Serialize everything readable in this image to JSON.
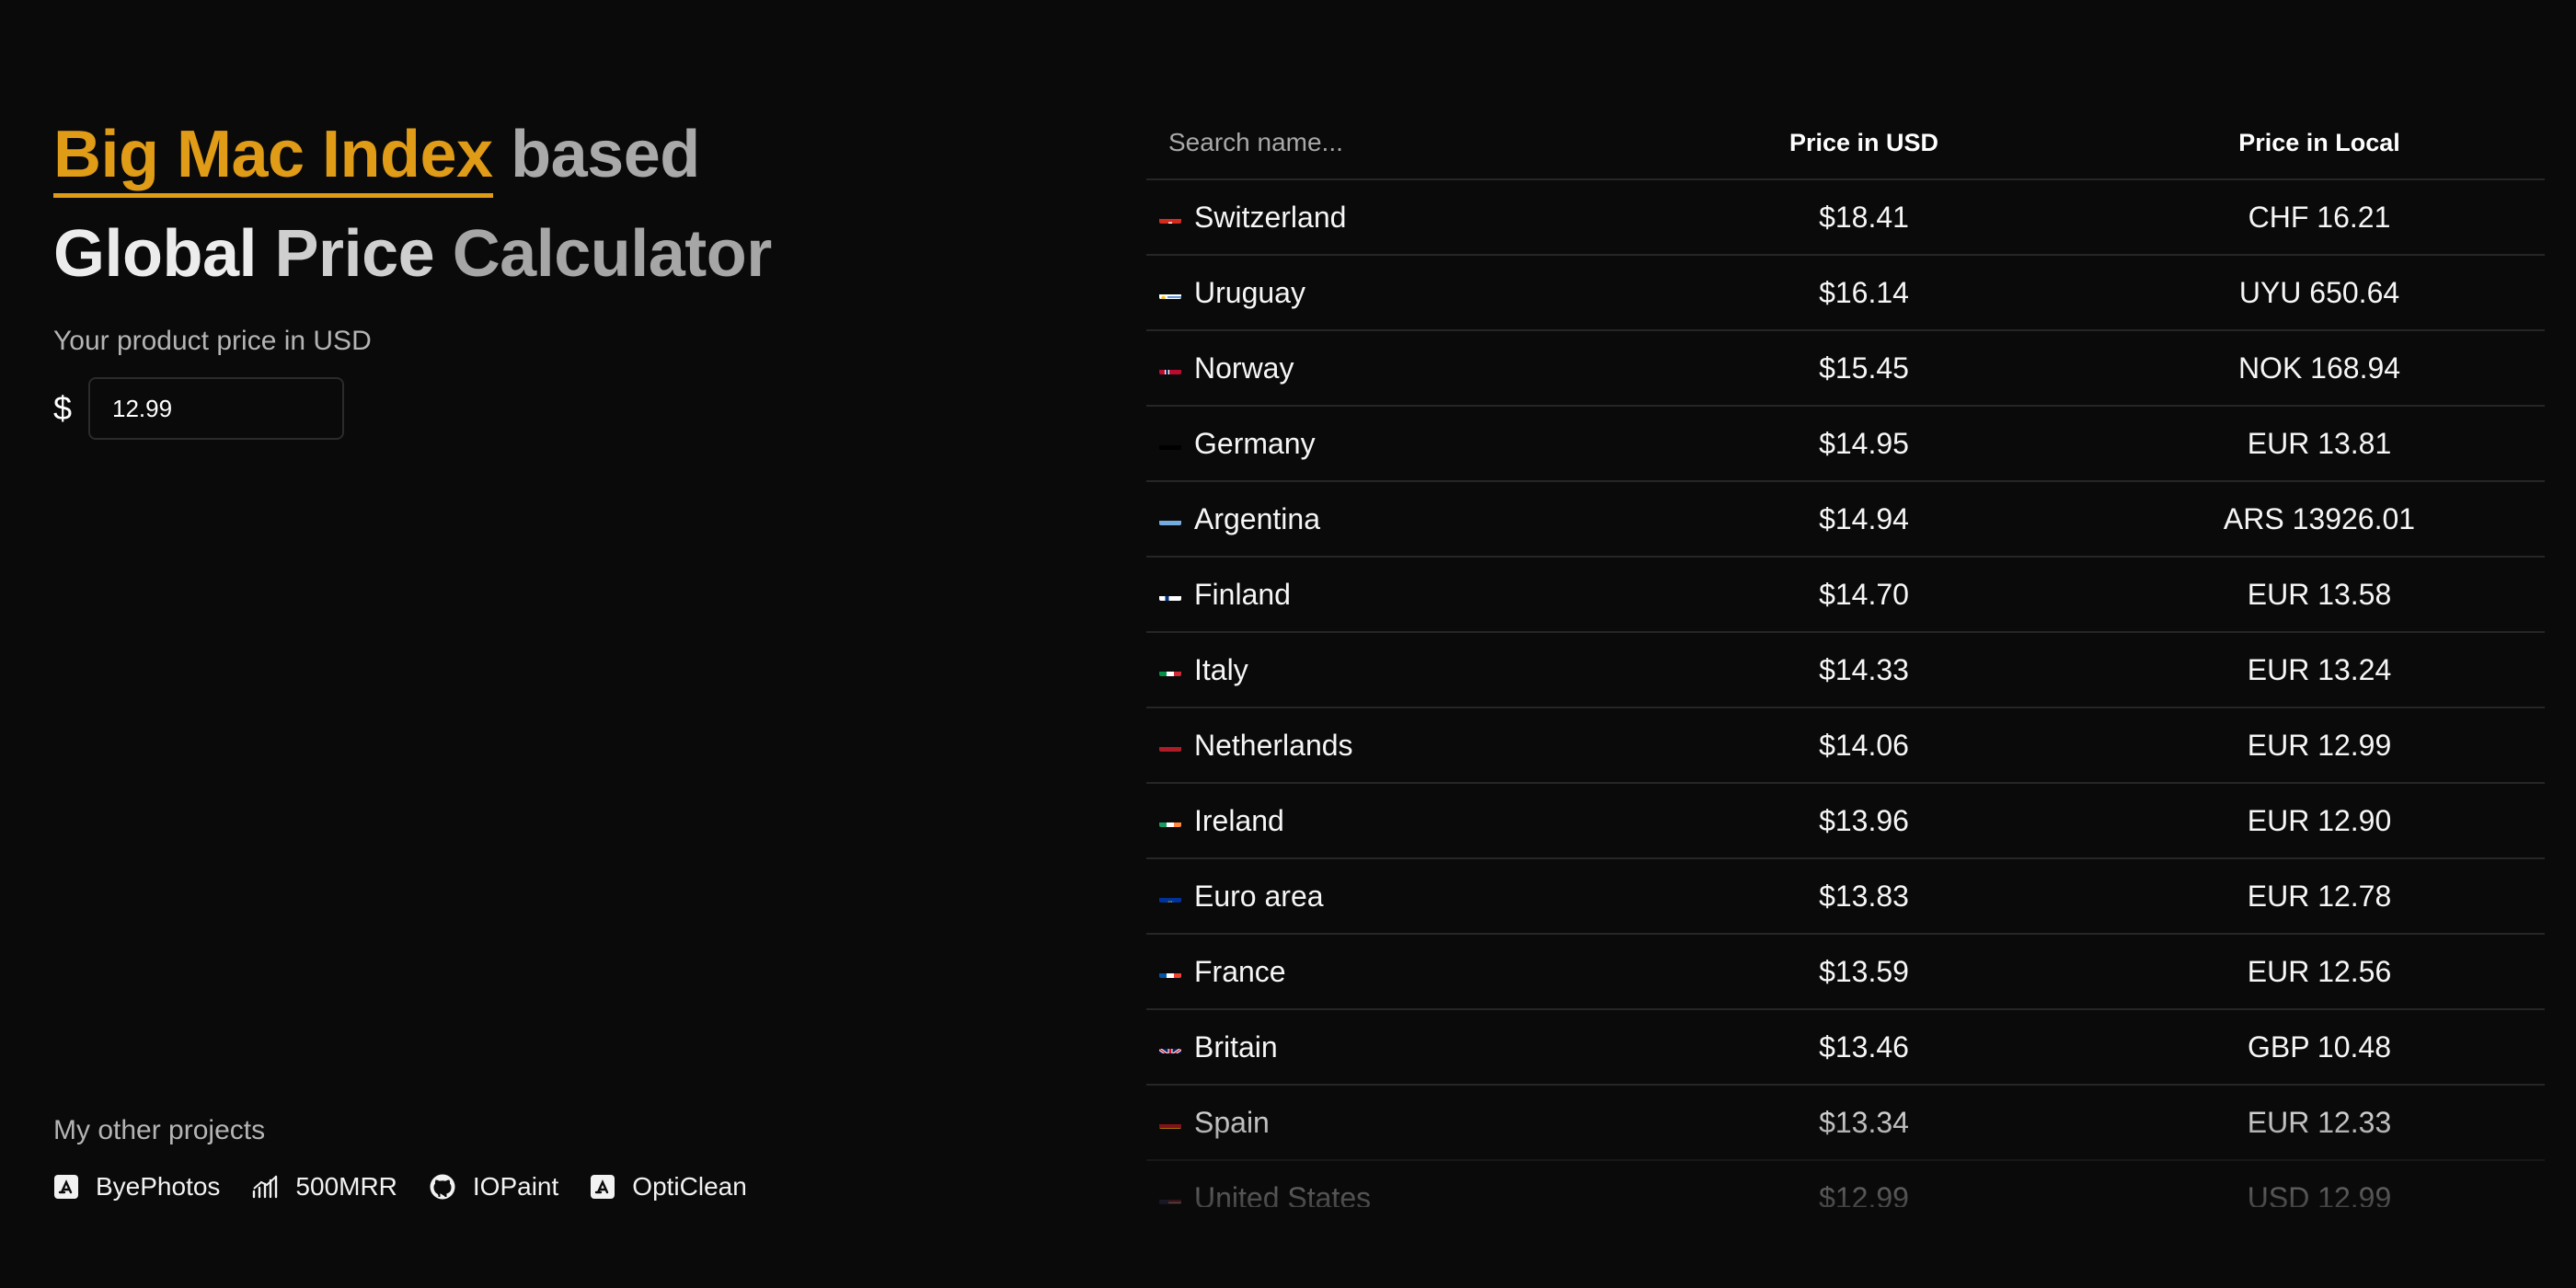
{
  "header": {
    "highlight": "Big Mac Index",
    "based": "based",
    "line2_words": [
      "Global",
      "Price",
      "Calculator"
    ]
  },
  "price_input": {
    "label": "Your product price in USD",
    "currency_symbol": "$",
    "value": "12.99"
  },
  "projects": {
    "title": "My other projects",
    "items": [
      {
        "label": "ByePhotos",
        "icon": "app-store-icon"
      },
      {
        "label": "500MRR",
        "icon": "chart-bars-icon"
      },
      {
        "label": "IOPaint",
        "icon": "github-icon"
      },
      {
        "label": "OptiClean",
        "icon": "app-store-icon"
      }
    ]
  },
  "table": {
    "search_placeholder": "Search name...",
    "columns": [
      "Price in USD",
      "Price in Local"
    ],
    "rows": [
      {
        "country": "Switzerland",
        "flag": "switzerland-flag-icon",
        "usd": "$18.41",
        "local": "CHF 16.21"
      },
      {
        "country": "Uruguay",
        "flag": "uruguay-flag-icon",
        "usd": "$16.14",
        "local": "UYU 650.64"
      },
      {
        "country": "Norway",
        "flag": "norway-flag-icon",
        "usd": "$15.45",
        "local": "NOK 168.94"
      },
      {
        "country": "Germany",
        "flag": "germany-flag-icon",
        "usd": "$14.95",
        "local": "EUR 13.81"
      },
      {
        "country": "Argentina",
        "flag": "argentina-flag-icon",
        "usd": "$14.94",
        "local": "ARS 13926.01"
      },
      {
        "country": "Finland",
        "flag": "finland-flag-icon",
        "usd": "$14.70",
        "local": "EUR 13.58"
      },
      {
        "country": "Italy",
        "flag": "italy-flag-icon",
        "usd": "$14.33",
        "local": "EUR 13.24"
      },
      {
        "country": "Netherlands",
        "flag": "netherlands-flag-icon",
        "usd": "$14.06",
        "local": "EUR 12.99"
      },
      {
        "country": "Ireland",
        "flag": "ireland-flag-icon",
        "usd": "$13.96",
        "local": "EUR 12.90"
      },
      {
        "country": "Euro area",
        "flag": "eu-flag-icon",
        "usd": "$13.83",
        "local": "EUR 12.78"
      },
      {
        "country": "France",
        "flag": "france-flag-icon",
        "usd": "$13.59",
        "local": "EUR 12.56"
      },
      {
        "country": "Britain",
        "flag": "britain-flag-icon",
        "usd": "$13.46",
        "local": "GBP 10.48"
      },
      {
        "country": "Spain",
        "flag": "spain-flag-icon",
        "usd": "$13.34",
        "local": "EUR 12.33"
      },
      {
        "country": "United States",
        "flag": "united-states-flag-icon",
        "usd": "$12.99",
        "local": "USD 12.99"
      }
    ]
  },
  "colors": {
    "background": "#0a0a0a",
    "accent": "#e09b17",
    "divider": "#262626"
  }
}
